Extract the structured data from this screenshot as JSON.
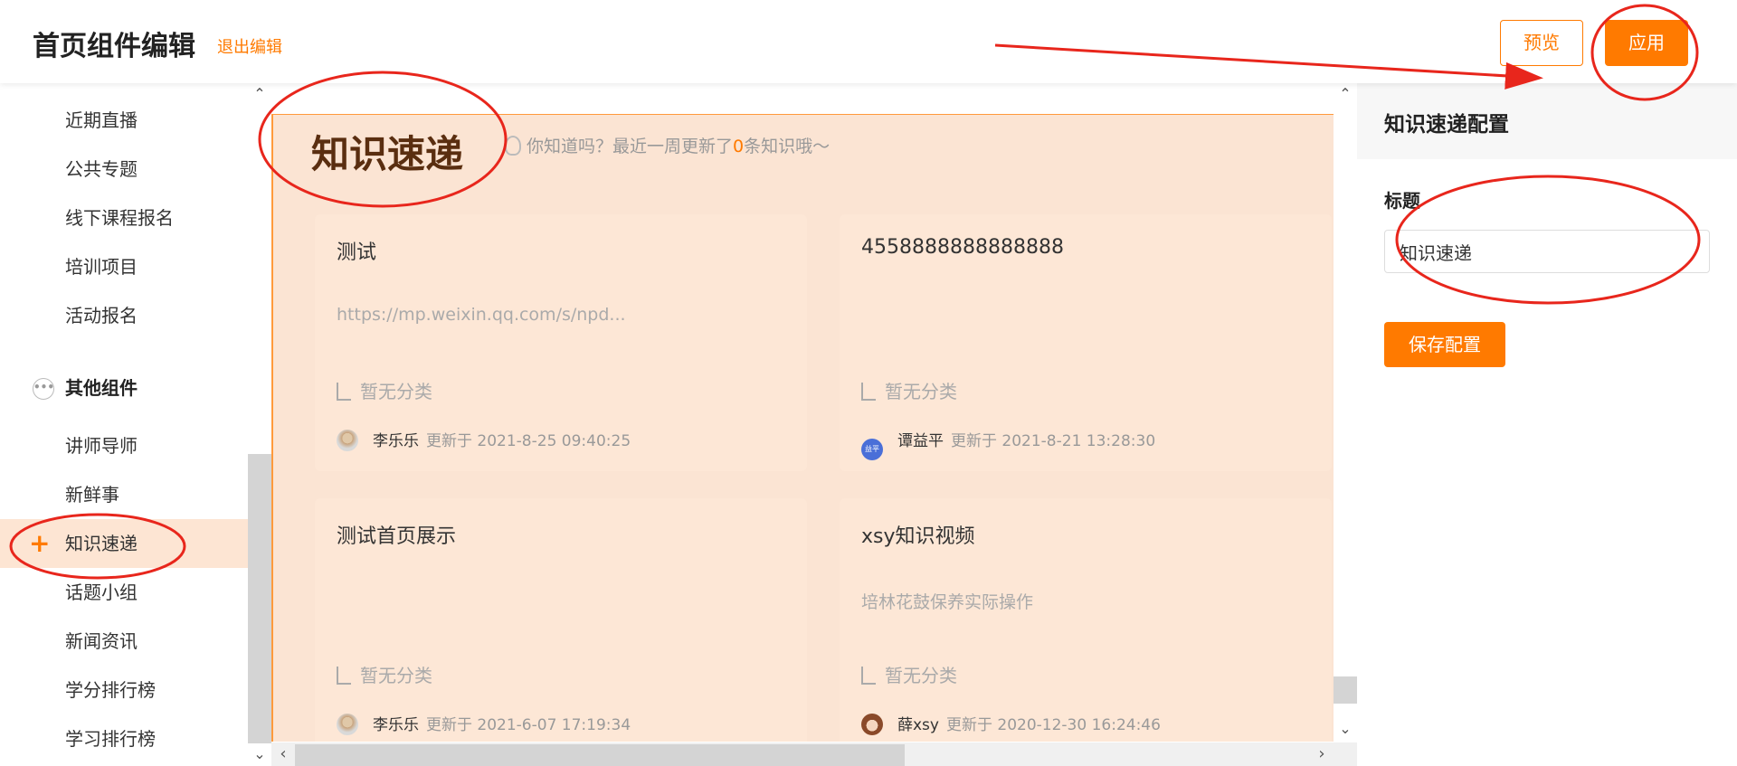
{
  "header": {
    "title": "首页组件编辑",
    "exit_label": "退出编辑",
    "preview_label": "预览",
    "apply_label": "应用"
  },
  "sidebar": {
    "items_top": [
      {
        "label": "近期直播"
      },
      {
        "label": "公共专题"
      },
      {
        "label": "线下课程报名"
      },
      {
        "label": "培训项目"
      },
      {
        "label": "活动报名"
      }
    ],
    "group_label": "其他组件",
    "items_bottom": [
      {
        "label": "讲师导师"
      },
      {
        "label": "新鲜事"
      },
      {
        "label": "知识速递",
        "active": true
      },
      {
        "label": "话题小组"
      },
      {
        "label": "新闻资讯"
      },
      {
        "label": "学分排行榜"
      },
      {
        "label": "学习排行榜"
      }
    ]
  },
  "preview": {
    "section_title": "知识速递",
    "hint_prefix": "你知道吗？最近一周更新了",
    "hint_count": "0",
    "hint_suffix": "条知识哦～",
    "cards": [
      {
        "title": "测试",
        "subtitle": "https://mp.weixin.qq.com/s/npd...",
        "category": "暂无分类",
        "author": "李乐乐",
        "updated": "更新于 2021-8-25 09:40:25"
      },
      {
        "title": "4558888888888888",
        "subtitle": "",
        "category": "暂无分类",
        "author": "谭益平",
        "avatar_text": "益平",
        "updated": "更新于 2021-8-21 13:28:30"
      },
      {
        "title": "测试首页展示",
        "subtitle": "",
        "category": "暂无分类",
        "author": "李乐乐",
        "updated": "更新于 2021-6-07 17:19:34"
      },
      {
        "title": "xsy知识视频",
        "subtitle": "培林花鼓保养实际操作",
        "category": "暂无分类",
        "author": "薛xsy",
        "updated": "更新于 2020-12-30 16:24:46"
      }
    ]
  },
  "config": {
    "title": "知识速递配置",
    "field_label": "标题",
    "field_value": "知识速递",
    "save_label": "保存配置"
  },
  "colors": {
    "accent": "#ff7a00",
    "canvas_bg": "#fbe4d3",
    "card_bg": "#fde7d6",
    "annotation": "#e8261c"
  }
}
